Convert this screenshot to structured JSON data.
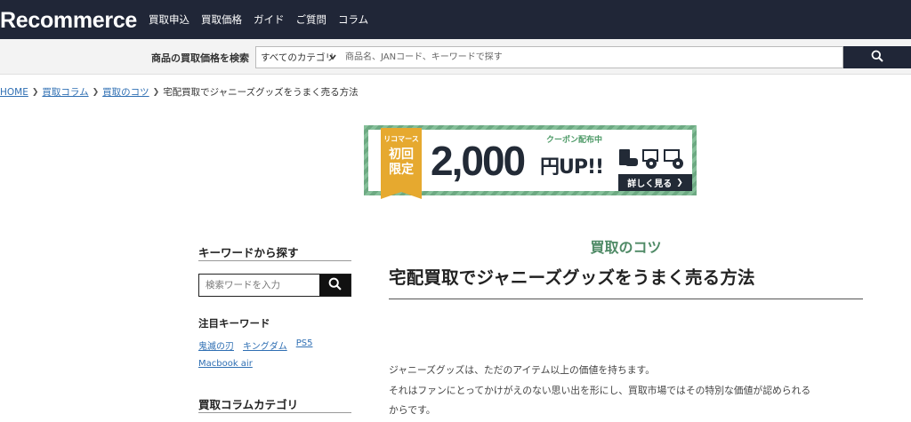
{
  "header": {
    "logo": "Recommerce",
    "nav": [
      "買取申込",
      "買取価格",
      "ガイド",
      "ご質問",
      "コラム"
    ]
  },
  "search": {
    "label": "商品の買取価格を検索",
    "category": "すべてのカテゴリ",
    "placeholder": "商品名、JANコード、キーワードで探す"
  },
  "breadcrumb": {
    "home": "HOME",
    "column": "買取コラム",
    "tips": "買取のコツ",
    "current": "宅配買取でジャニーズグッズをうまく売る方法"
  },
  "banner": {
    "brand": "リコマース",
    "first_time": "初回",
    "limited": "限定",
    "amount": "2,000",
    "unit": "円UP!!",
    "coupon": "クーポン配布中",
    "detail_button": "詳しく見る"
  },
  "sidebar": {
    "keyword_heading": "キーワードから探す",
    "search_placeholder": "検索ワードを入力",
    "featured_heading": "注目キーワード",
    "keywords": [
      "鬼滅の刃",
      "キングダム",
      "PS5",
      "Macbook air"
    ],
    "category_heading": "買取コラムカテゴリ"
  },
  "article": {
    "category": "買取のコツ",
    "title": "宅配買取でジャニーズグッズをうまく売る方法",
    "paragraphs": [
      "ジャニーズグッズは、ただのアイテム以上の価値を持ちます。",
      "それはファンにとってかけがえのない思い出を形にし、買取市場ではその特別な価値が認められる",
      "からです。"
    ]
  },
  "colors": {
    "header_bg": "#202637",
    "accent_green": "#4f8a66",
    "link_blue": "#2f6fb3",
    "ribbon_gold": "#e6a92f"
  }
}
